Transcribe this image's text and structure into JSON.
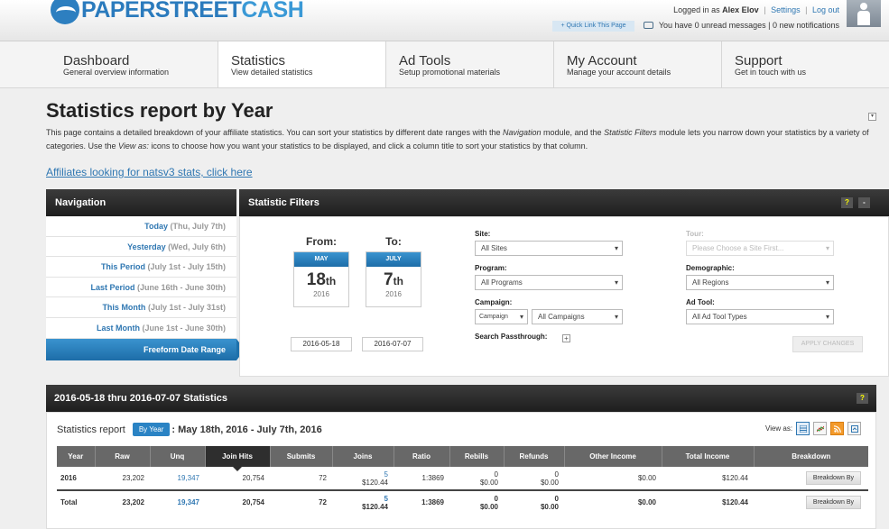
{
  "header": {
    "logo_text_1": "PAPERSTREET",
    "logo_text_2": "CASH",
    "quick_link": "+ Quick Link This Page",
    "logged_in_prefix": "Logged in as",
    "user_name": "Alex Elov",
    "settings": "Settings",
    "logout": "Log out",
    "messages": "You have 0 unread messages | 0 new notifications"
  },
  "topnav": [
    {
      "title": "Dashboard",
      "sub": "General overview information"
    },
    {
      "title": "Statistics",
      "sub": "View detailed statistics"
    },
    {
      "title": "Ad Tools",
      "sub": "Setup promotional materials"
    },
    {
      "title": "My Account",
      "sub": "Manage your account details"
    },
    {
      "title": "Support",
      "sub": "Get in touch with us"
    }
  ],
  "page": {
    "title": "Statistics report by Year",
    "intro_1": "This page contains a detailed breakdown of your affiliate statistics. You can sort your statistics by different date ranges with the ",
    "intro_nav": "Navigation",
    "intro_2": " module, and the ",
    "intro_sf": "Statistic Filters",
    "intro_3": " module lets you narrow down your statistics by a variety of categories. Use the ",
    "intro_va": "View as:",
    "intro_4": " icons to choose how you want your statistics to be displayed, and click a column title to sort your statistics by that column.",
    "natsv3_link": "Affiliates looking for natsv3 stats, click here"
  },
  "navigation": {
    "title": "Navigation",
    "items": [
      {
        "label": "Today",
        "date": "(Thu, July 7th)"
      },
      {
        "label": "Yesterday",
        "date": "(Wed, July 6th)"
      },
      {
        "label": "This Period",
        "date": "(July 1st - July 15th)"
      },
      {
        "label": "Last Period",
        "date": "(June 16th - June 30th)"
      },
      {
        "label": "This Month",
        "date": "(July 1st - July 31st)"
      },
      {
        "label": "Last Month",
        "date": "(June 1st - June 30th)"
      }
    ],
    "active": "Freeform Date Range"
  },
  "filters": {
    "title": "Statistic Filters",
    "help": "?",
    "collapse": "-",
    "from_label": "From:",
    "from_month": "MAY",
    "from_day": "18",
    "from_suffix": "th",
    "from_year": "2016",
    "from_value": "2016-05-18",
    "to_label": "To:",
    "to_month": "JULY",
    "to_day": "7",
    "to_suffix": "th",
    "to_year": "2016",
    "to_value": "2016-07-07",
    "site_label": "Site:",
    "site_value": "All Sites",
    "program_label": "Program:",
    "program_value": "All Programs",
    "campaign_label": "Campaign:",
    "campaign_type": "Campaign",
    "campaign_value": "All Campaigns",
    "passthrough_label": "Search Passthrough:",
    "tour_label": "Tour:",
    "tour_value": "Please Choose a Site First...",
    "demographic_label": "Demographic:",
    "demographic_value": "All Regions",
    "adtool_label": "Ad Tool:",
    "adtool_value": "All Ad Tool Types",
    "apply": "APPLY CHANGES"
  },
  "stats": {
    "title": "2016-05-18 thru 2016-07-07 Statistics",
    "help": "?",
    "report_label": "Statistics report",
    "report_badge": "By Year",
    "report_range": "May 18th, 2016 - July 7th, 2016",
    "view_as": "View as:",
    "columns": [
      "Year",
      "Raw",
      "Unq",
      "Join Hits",
      "Submits",
      "Joins",
      "Ratio",
      "Rebills",
      "Refunds",
      "Other Income",
      "Total Income",
      "Breakdown"
    ],
    "rows": [
      {
        "year": "2016",
        "raw": "23,202",
        "unq": "19,347",
        "join_hits": "20,754",
        "submits": "72",
        "joins": "5",
        "joins_amt": "$120.44",
        "ratio": "1:3869",
        "rebills": "0",
        "rebills_amt": "$0.00",
        "refunds": "0",
        "refunds_amt": "$0.00",
        "other": "$0.00",
        "total": "$120.44",
        "breakdown": "Breakdown By"
      },
      {
        "year": "Total",
        "raw": "23,202",
        "unq": "19,347",
        "join_hits": "20,754",
        "submits": "72",
        "joins": "5",
        "joins_amt": "$120.44",
        "ratio": "1:3869",
        "rebills": "0",
        "rebills_amt": "$0.00",
        "refunds": "0",
        "refunds_amt": "$0.00",
        "other": "$0.00",
        "total": "$120.44",
        "breakdown": "Breakdown By"
      }
    ]
  }
}
